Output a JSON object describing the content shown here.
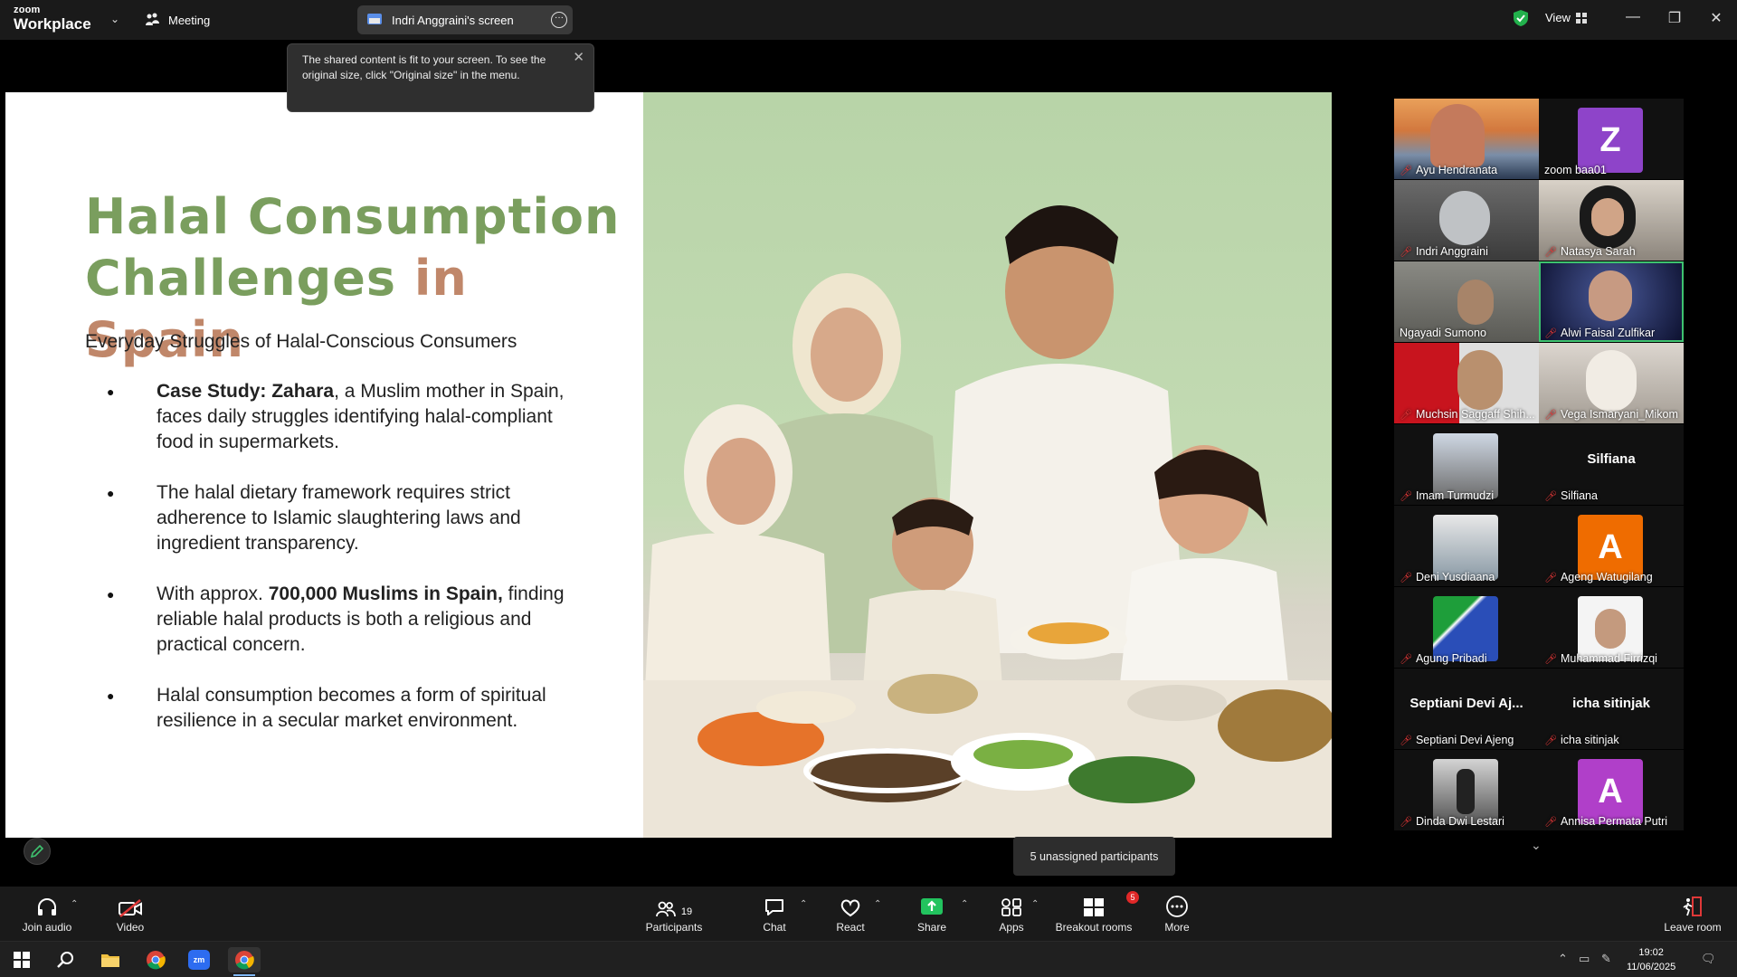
{
  "app": {
    "logo_line1": "zoom",
    "logo_line2": "Workplace",
    "meeting_label": "Meeting",
    "screen_share_label": "Indri Anggraini's screen",
    "view_label": "View"
  },
  "tooltip": {
    "text": "The shared content is fit to your screen. To see the original size, click \"Original size\" in the menu."
  },
  "slide": {
    "title_line1": "Halal Consumption",
    "title_line2_part1": "Challenges ",
    "title_line2_part2": "in Spain",
    "subtitle": "Everyday Struggles of Halal-Conscious Consumers",
    "bullets": [
      {
        "bold": "Case Study: Zahara",
        "text": ", a Muslim mother in Spain, faces daily struggles identifying halal-compliant food in supermarkets."
      },
      {
        "bold": "",
        "text": "The halal dietary framework requires strict adherence to Islamic slaughtering laws and ingredient transparency."
      },
      {
        "pre": "With approx. ",
        "bold": "700,000 Muslims in Spain,",
        "text": " finding reliable halal products is both a religious and practical concern."
      },
      {
        "bold": "",
        "text": "Halal consumption becomes a form of spiritual resilience in a secular market environment."
      }
    ]
  },
  "gallery": {
    "participants": [
      {
        "name": "Ayu Hendranata",
        "type": "video"
      },
      {
        "name": "zoom baa01",
        "type": "avatar",
        "initial": "Z",
        "color": "#8e44c9"
      },
      {
        "name": "Indri Anggraini",
        "type": "video"
      },
      {
        "name": "Natasya Sarah",
        "type": "video"
      },
      {
        "name": "Ngayadi Sumono",
        "type": "video"
      },
      {
        "name": "Alwi Faisal Zulfikar",
        "type": "video",
        "active": true
      },
      {
        "name": "Muchsin Saggaff Shih...",
        "type": "video"
      },
      {
        "name": "Vega Ismaryani_Mikom",
        "type": "video"
      },
      {
        "name": "Imam Turmudzi",
        "type": "photo"
      },
      {
        "name": "Silfiana",
        "type": "text",
        "display": "Silfiana"
      },
      {
        "name": "Deni Yusdiaana",
        "type": "photo"
      },
      {
        "name": "Ageng Watugilang",
        "type": "avatar",
        "initial": "A",
        "color": "#ef6c00"
      },
      {
        "name": "Agung Pribadi",
        "type": "photo"
      },
      {
        "name": "Muhammad Firrizqi",
        "type": "photo"
      },
      {
        "name": "Septiani Devi Ajeng",
        "type": "text",
        "display": "Septiani  Devi  Aj..."
      },
      {
        "name": "icha sitinjak",
        "type": "text",
        "display": "icha sitinjak"
      },
      {
        "name": "Dinda Dwi Lestari",
        "type": "photo"
      },
      {
        "name": "Annisa Permata Putri",
        "type": "avatar",
        "initial": "A",
        "color": "#b03fc9"
      }
    ]
  },
  "unassigned": "5 unassigned participants",
  "toolbar": {
    "join_audio": "Join audio",
    "video": "Video",
    "participants": "Participants",
    "participants_count": "19",
    "chat": "Chat",
    "react": "React",
    "share": "Share",
    "apps": "Apps",
    "breakout": "Breakout rooms",
    "breakout_badge": "5",
    "more": "More",
    "leave": "Leave room"
  },
  "taskbar": {
    "time": "19:02",
    "date": "11/06/2025"
  },
  "colors": {
    "title_green": "#7a9e5e",
    "title_accent": "#c0876a",
    "active_border": "#3ec26f",
    "share_green": "#22c35e",
    "mute_red": "#e03838"
  }
}
